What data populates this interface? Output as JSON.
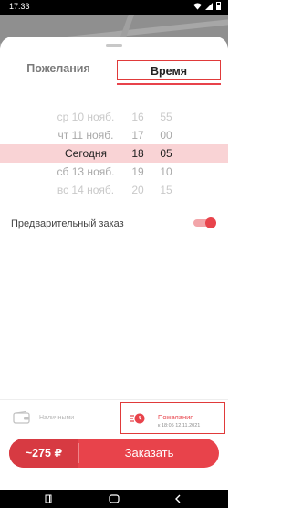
{
  "status": {
    "time": "17:33"
  },
  "tabs": {
    "wishes": "Пожелания",
    "time": "Время"
  },
  "picker": {
    "rows": [
      {
        "day": "ср 10 нояб.",
        "hour": "16",
        "minute": "55"
      },
      {
        "day": "чт 11 нояб.",
        "hour": "17",
        "minute": "00"
      },
      {
        "day": "Сегодня",
        "hour": "18",
        "minute": "05"
      },
      {
        "day": "сб 13 нояб.",
        "hour": "19",
        "minute": "10"
      },
      {
        "day": "вс 14 нояб.",
        "hour": "20",
        "minute": "15"
      }
    ],
    "selected_index": 2
  },
  "preorder": {
    "label": "Предварительный заказ",
    "enabled": true
  },
  "payment": {
    "label": "Наличными",
    "icon": "wallet-icon"
  },
  "wishes_summary": {
    "title": "Пожелания",
    "subtitle": "к 18:05 12.11.2021",
    "icon": "clock-icon"
  },
  "order_button": {
    "price": "~275 ₽",
    "label": "Заказать"
  },
  "colors": {
    "accent": "#e8434b",
    "highlight": "#f9d3d5",
    "annotation": "#e03a3a"
  }
}
